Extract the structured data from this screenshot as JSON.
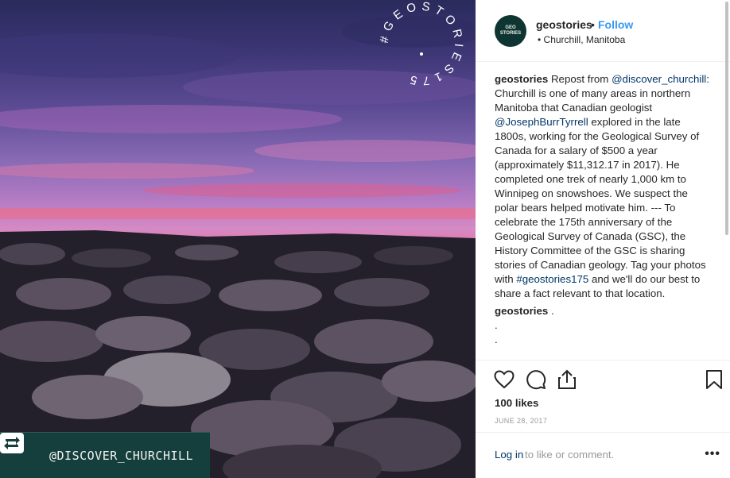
{
  "photo": {
    "watermark_text": "#GEOSTORIES175",
    "stamp_text": "@DISCOVER_CHURCHILL"
  },
  "header": {
    "username": "geostories",
    "separator": "•",
    "follow": "Follow",
    "location": "• Churchill, Manitoba",
    "avatar_text": [
      "GEO",
      "STORIES"
    ]
  },
  "caption": {
    "user": "geostories",
    "t1": " Repost from ",
    "mention1": "@discover_churchill",
    "t2": ": Churchill is one of many areas in northern Manitoba that Canadian geologist ",
    "mention2": "@JosephBurrTyrrell",
    "t3": " explored in the late 1800s, working for the Geological Survey of Canada for a salary of $500 a year (approximately $11,312.17 in 2017). He completed one trek of nearly 1,000 km to Winnipeg on snowshoes. We suspect the polar bears helped motivate him. --- To celebrate the 175th anniversary of the Geological Survey of Canada (GSC), the History Committee of the GSC is sharing stories of Canadian geology. Tag your photos with ",
    "hashtag": "#geostories175",
    "t4": " and we'll do our best to share a fact relevant to that location."
  },
  "comment": {
    "user": "geostories",
    "text": " .",
    "lines": [
      ".",
      "."
    ]
  },
  "actions": {
    "like_icon": "heart-icon",
    "comment_icon": "comment-icon",
    "share_icon": "share-icon",
    "save_icon": "bookmark-icon"
  },
  "likes": "100 likes",
  "date": "JUNE 28, 2017",
  "footer": {
    "login": "Log in",
    "rest": "to like or comment.",
    "more": "•••"
  },
  "colors": {
    "link": "#003569",
    "follow": "#3897f0",
    "stamp_bg": "#153f3c",
    "avatar_bg": "#0f3532"
  }
}
